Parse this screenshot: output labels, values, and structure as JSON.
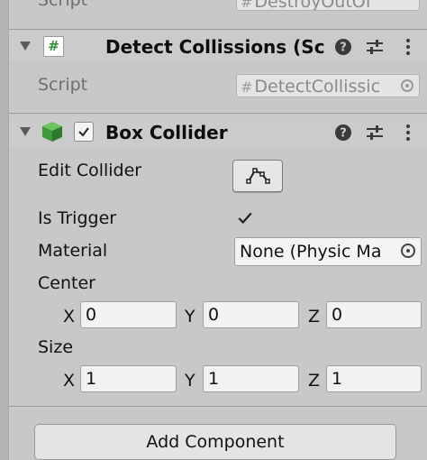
{
  "prev_component": {
    "script_label": "Script",
    "script_value": "DestroyOutOf"
  },
  "detect": {
    "title": "Detect Collissions (Sc",
    "script_label": "Script",
    "script_value": "DetectCollissic"
  },
  "box_collider": {
    "title": "Box Collider",
    "edit_collider_label": "Edit Collider",
    "is_trigger_label": "Is Trigger",
    "is_trigger_checked": true,
    "material_label": "Material",
    "material_value": "None (Physic Ma",
    "center_label": "Center",
    "center": {
      "x": "0",
      "y": "0",
      "z": "0"
    },
    "size_label": "Size",
    "size": {
      "x": "1",
      "y": "1",
      "z": "1"
    },
    "axis_labels": {
      "x": "X",
      "y": "Y",
      "z": "Z"
    }
  },
  "add_component_label": "Add Component",
  "icons": {
    "help": "question-circle-icon",
    "presets": "sliders-icon",
    "menu": "kebab-menu-icon",
    "script": "csharp-script-icon",
    "collider": "green-cube-icon",
    "edit": "edit-collider-icon"
  },
  "colors": {
    "panel_bg": "#c8c8c8",
    "field_bg": "#f2f2f2",
    "script_green": "#2f8f3a",
    "cube_green": "#3c9a3a"
  }
}
